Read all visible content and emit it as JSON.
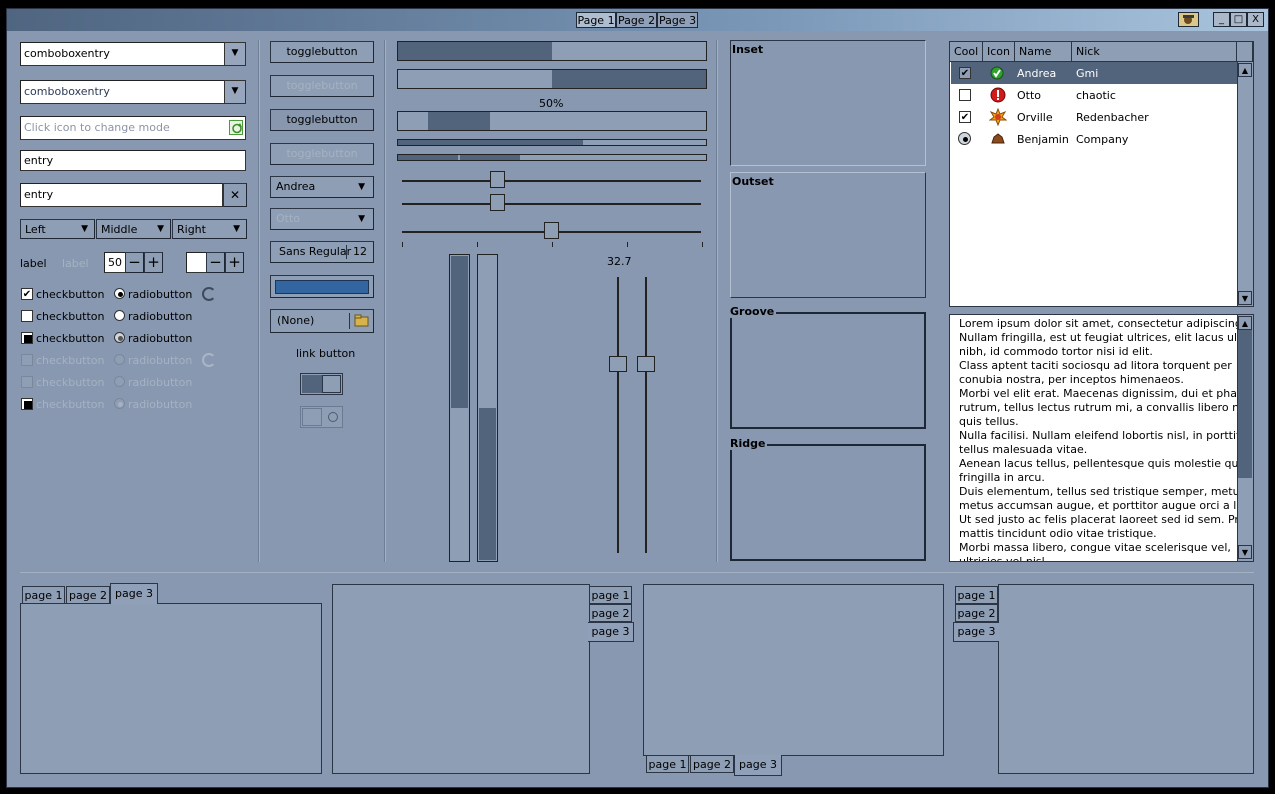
{
  "titlebar": {
    "tabs": [
      "Page 1",
      "Page 2",
      "Page 3"
    ],
    "buttons": [
      "_",
      "□",
      "X"
    ]
  },
  "col1": {
    "combo1": "comboboxentry",
    "combo2": "comboboxentry",
    "icon_entry_placeholder": "Click icon to change mode",
    "entry1": "entry",
    "entry2": "entry",
    "clear": "✕",
    "combos": [
      "Left",
      "Middle",
      "Right"
    ],
    "label": "label",
    "label_dis": "label",
    "spin_value": "50",
    "spin_minus": "−",
    "spin_plus": "+",
    "check_rows": [
      {
        "check": "checkbutton",
        "radio": "radiobutton"
      },
      {
        "check": "checkbutton",
        "radio": "radiobutton"
      },
      {
        "check": "checkbutton",
        "radio": "radiobutton"
      },
      {
        "check": "checkbutton",
        "radio": "radiobutton"
      },
      {
        "check": "checkbutton",
        "radio": "radiobutton"
      },
      {
        "check": "checkbutton",
        "radio": "radiobutton"
      }
    ]
  },
  "col2": {
    "toggles": [
      "togglebutton",
      "togglebutton",
      "togglebutton",
      "togglebutton"
    ],
    "combo_andrea": "Andrea",
    "combo_otto": "Otto",
    "font_name": "Sans Regular",
    "font_size": "12",
    "file_none": "(None)",
    "link": "link button"
  },
  "col3": {
    "progress_label": "50%",
    "scale_value": "32.7",
    "progress": {
      "bar1": 0.5,
      "bar2": 0.5,
      "bar3": 0.3
    },
    "vbars": [
      0.5,
      0.5
    ]
  },
  "frames": [
    "Inset",
    "Outset",
    "Groove",
    "Ridge"
  ],
  "tree": {
    "headers": [
      "Cool",
      "Icon",
      "Name",
      "Nick"
    ],
    "rows": [
      {
        "name": "Andrea",
        "nick": "Gmi",
        "icon": "check-circle-icon",
        "cool": true
      },
      {
        "name": "Otto",
        "nick": "chaotic",
        "icon": "error-icon",
        "cool": false
      },
      {
        "name": "Orville",
        "nick": "Redenbacher",
        "icon": "burst-icon",
        "cool": true
      },
      {
        "name": "Benjamin",
        "nick": "Company",
        "icon": "dog-icon",
        "cool": "radio"
      }
    ]
  },
  "textview": {
    "lines": [
      "Lorem ipsum dolor sit amet, consectetur adipiscing elit.",
      "Nullam fringilla, est ut feugiat ultrices, elit lacus ultricies",
      "nibh, id commodo tortor nisi id elit.",
      "Class aptent taciti sociosqu ad litora torquent per",
      "conubia nostra, per inceptos himenaeos.",
      "Morbi vel elit erat. Maecenas dignissim, dui et pharetra",
      "rutrum, tellus lectus rutrum mi, a convallis libero nisi",
      "quis tellus.",
      "Nulla facilisi. Nullam eleifend lobortis nisl, in porttitor",
      "tellus malesuada vitae.",
      "Aenean lacus tellus, pellentesque quis molestie quis,",
      "fringilla in arcu.",
      "Duis elementum, tellus sed tristique semper, metus",
      "metus accumsan augue, et porttitor augue orci a libero.",
      "Ut sed justo ac felis placerat laoreet sed id sem. Proin",
      "mattis tincidunt odio vitae tristique.",
      "Morbi massa libero, congue vitae scelerisque vel,",
      "ultricies vel nisl."
    ]
  },
  "notebooks": {
    "nb1": [
      "page 1",
      "page 2",
      "page 3"
    ],
    "nb2": [
      "page 1",
      "page 2",
      "page 3"
    ],
    "nb3": [
      "page 1",
      "page 2",
      "page 3"
    ],
    "nb4": [
      "page 1",
      "page 2",
      "page 3"
    ]
  }
}
